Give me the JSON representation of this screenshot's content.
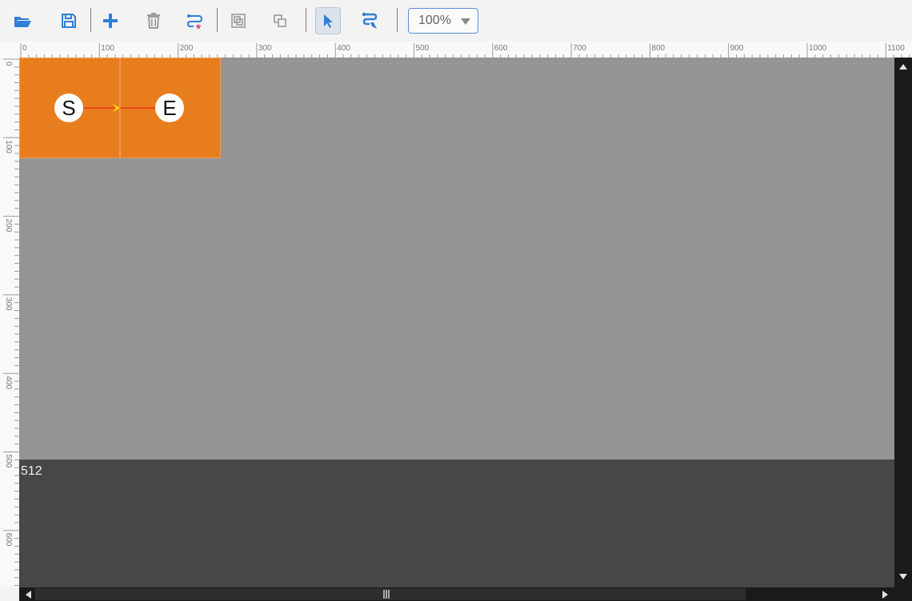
{
  "toolbar": {
    "buttons": [
      {
        "name": "open-folder",
        "icon": "folder-open-icon"
      },
      {
        "name": "save",
        "icon": "floppy-disk-icon"
      },
      {
        "name": "add",
        "icon": "plus-icon"
      },
      {
        "name": "delete",
        "icon": "trash-icon"
      },
      {
        "name": "clear-route",
        "icon": "route-remove-icon"
      },
      {
        "name": "group",
        "icon": "group-icon"
      },
      {
        "name": "ungroup",
        "icon": "ungroup-icon"
      },
      {
        "name": "select-tool",
        "icon": "cursor-arrow-icon",
        "active": true
      },
      {
        "name": "route-tool",
        "icon": "route-draw-icon"
      }
    ],
    "zoom": {
      "value": "100%"
    }
  },
  "rulers": {
    "horizontal_labels": [
      "0",
      "100",
      "200",
      "300",
      "400",
      "500",
      "600",
      "700",
      "800",
      "900",
      "1000",
      "1100"
    ],
    "vertical_labels": [
      "0",
      "100",
      "200",
      "300",
      "400",
      "500",
      "600"
    ]
  },
  "canvas": {
    "tiles": 2,
    "route": {
      "start_label": "S",
      "end_label": "E"
    },
    "lower_region_label": "512"
  },
  "colors": {
    "accent_blue": "#2f7fd6",
    "tile_orange": "#e87d1e",
    "canvas_gray": "#959595",
    "dark_region": "#474747",
    "route_line": "#e53a1e",
    "route_arrow": "#ffe600"
  }
}
